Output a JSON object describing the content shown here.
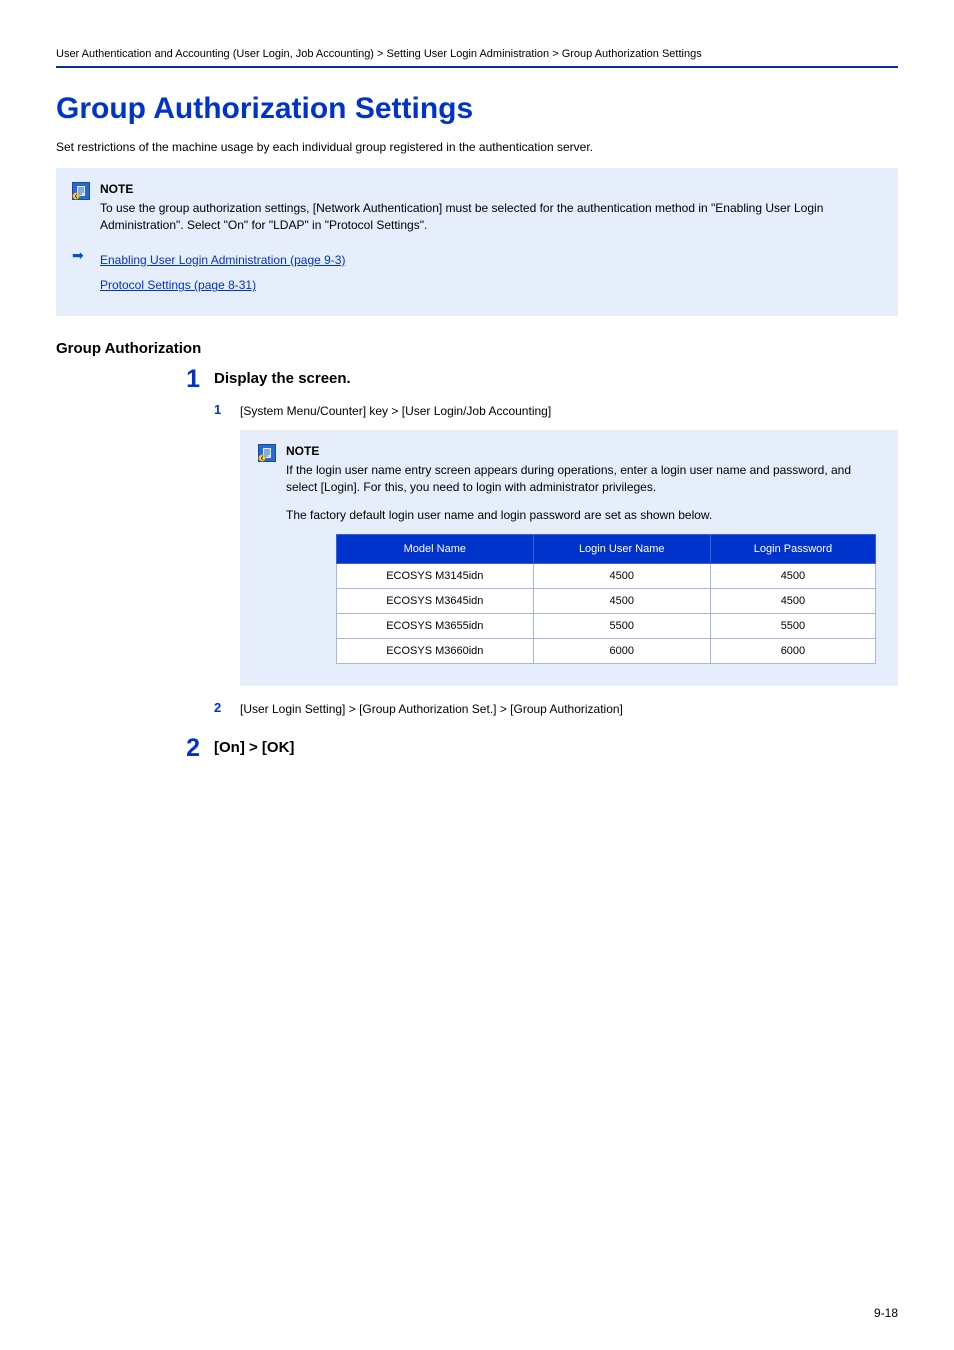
{
  "header": {
    "breadcrumb": "User Authentication and Accounting (User Login, Job Accounting) > Setting User Login Administration > Group Authorization Settings"
  },
  "title": "Group Authorization Settings",
  "intro": "Set restrictions of the machine usage by each individual group registered in the authentication server.",
  "top_note": {
    "heading": "NOTE",
    "body": "To use the group authorization settings, [Network Authentication] must be selected for the authentication method in \"Enabling User Login Administration\". Select \"On\" for \"LDAP\" in \"Protocol Settings\"."
  },
  "top_links": {
    "link1": "Enabling User Login Administration (page 9-3)",
    "link2": "Protocol Settings (page 8-31)"
  },
  "section_title": "Group Authorization",
  "step1": {
    "heading": "Display the screen.",
    "sub1": "[System Menu/Counter] key > [User Login/Job Accounting]",
    "inner_note_heading": "NOTE",
    "inner_note_body1": "If the login user name entry screen appears during operations, enter a login user name and password, and select [Login]. For this, you need to login with administrator privileges.",
    "inner_note_body2": "The factory default login user name and login password are set as shown below.",
    "table": {
      "headers": [
        "Model Name",
        "Login User Name",
        "Login Password"
      ],
      "rows": [
        [
          "ECOSYS M3145idn",
          "4500",
          "4500"
        ],
        [
          "ECOSYS M3645idn",
          "4500",
          "4500"
        ],
        [
          "ECOSYS M3655idn",
          "5500",
          "5500"
        ],
        [
          "ECOSYS M3660idn",
          "6000",
          "6000"
        ]
      ]
    },
    "sub2": "[User Login Setting] > [Group Authorization Set.] > [Group Authorization]"
  },
  "step2": {
    "heading": "[On] > [OK]"
  },
  "page_number": "9-18"
}
